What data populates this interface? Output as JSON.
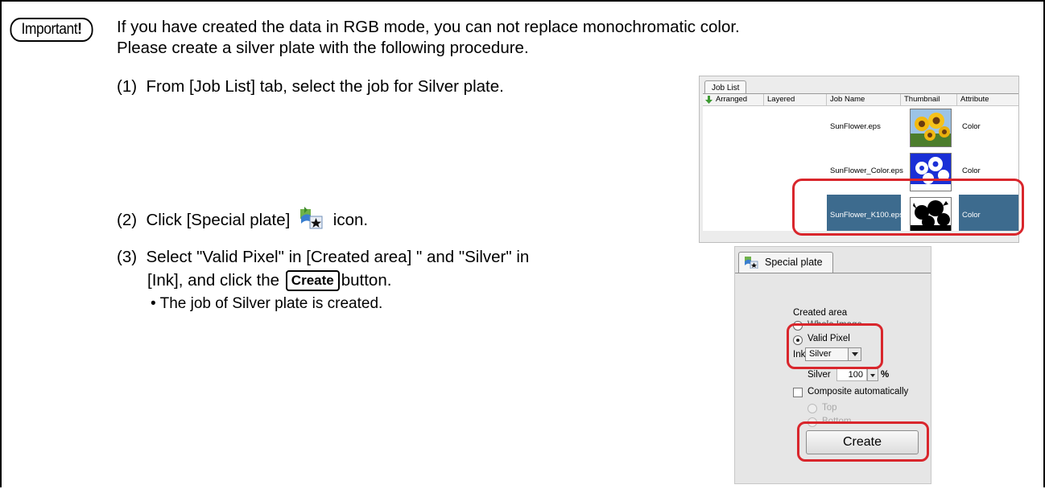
{
  "important_badge": {
    "text": "Important",
    "excl": "!"
  },
  "intro": {
    "line1": "If you have created the data in RGB mode, you can not replace monochromatic color.",
    "line2": "Please create a silver plate with the following procedure."
  },
  "steps": [
    {
      "num": "(1)",
      "text": "From [Job List] tab, select the job for Silver plate."
    },
    {
      "num": "(2)",
      "before": "Click [Special plate]",
      "after": "icon."
    },
    {
      "num": "(3)",
      "line1": "Select \"Valid Pixel\" in [Created area] \" and  \"Silver\" in",
      "line2_before": "[Ink], and click the",
      "button_label": "Create",
      "line2_after": "button.",
      "bullet": "• The job of Silver plate is created."
    }
  ],
  "job_list": {
    "tab": "Job List",
    "columns": [
      "Arranged",
      "Layered",
      "Job Name",
      "Thumbnail",
      "Attribute"
    ],
    "rows": [
      {
        "name": "SunFlower.eps",
        "attribute": "Color",
        "thumb": "sunflower-color"
      },
      {
        "name": "SunFlower_Color.eps",
        "attribute": "Color",
        "thumb": "sunflower-silhouette-blue"
      },
      {
        "name": "SunFlower_K100.eps",
        "attribute": "Color",
        "thumb": "sunflower-silhouette-black"
      }
    ],
    "selected_row": 2
  },
  "special_plate": {
    "tab": "Special plate",
    "created_area_label": "Created area",
    "options": [
      "Whole Image",
      "Valid Pixel"
    ],
    "selected_option": "Valid Pixel",
    "ink_label": "Ink",
    "ink_value": "Silver",
    "silver_label": "Silver",
    "silver_value": "100",
    "percent": "%",
    "composite_label": "Composite automatically",
    "position_options": [
      "Top",
      "Bottom"
    ],
    "create_label": "Create"
  },
  "colors": {
    "highlight": "#d9262c",
    "selection": "#3d6b8e"
  }
}
